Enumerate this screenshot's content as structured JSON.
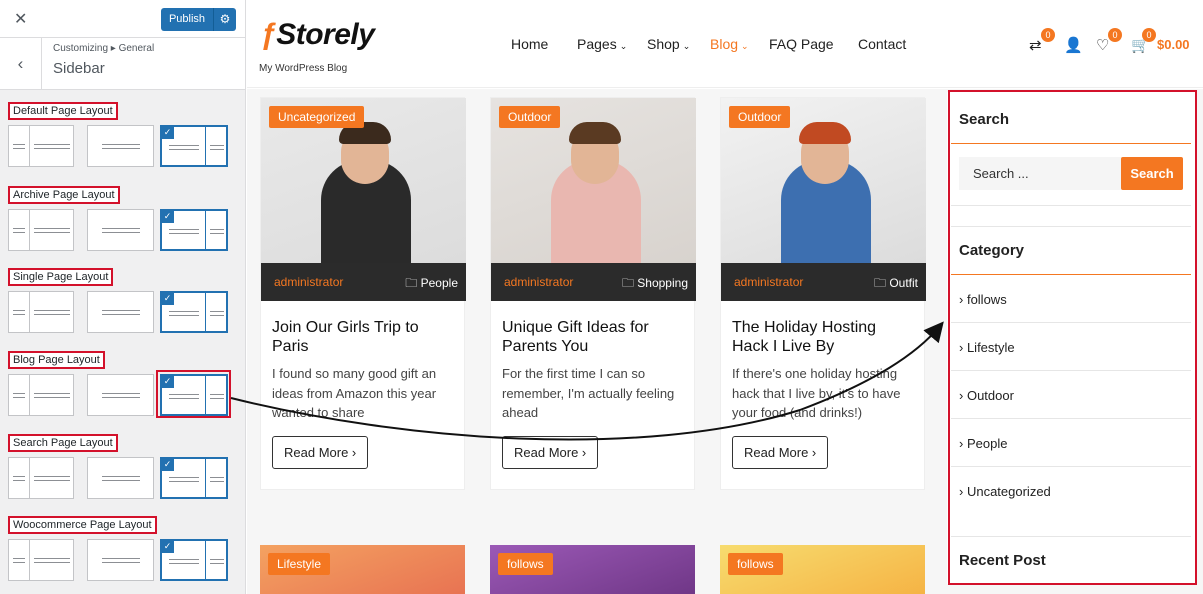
{
  "customizer": {
    "close_icon": "close-icon",
    "publish_label": "Publish",
    "settings_icon": "gear-icon",
    "back_icon": "chevron-left-icon",
    "breadcrumb": "Customizing ▸ General",
    "section_title": "Sidebar",
    "layout_groups": [
      {
        "label": "Default Page Layout",
        "selected": "right-sidebar"
      },
      {
        "label": "Archive Page Layout",
        "selected": "right-sidebar"
      },
      {
        "label": "Single Page Layout",
        "selected": "right-sidebar"
      },
      {
        "label": "Blog Page Layout",
        "selected": "right-sidebar"
      },
      {
        "label": "Search Page Layout",
        "selected": "right-sidebar"
      },
      {
        "label": "Woocommerce Page Layout",
        "selected": "right-sidebar"
      }
    ],
    "check_icon": "✓",
    "accent_color": "#2271b1",
    "highlight_color": "#d3112b"
  },
  "site": {
    "logo_text": "Storely",
    "tagline": "My WordPress Blog",
    "menu": [
      {
        "label": "Home",
        "dropdown": false,
        "active": false
      },
      {
        "label": "Pages",
        "dropdown": true,
        "active": false
      },
      {
        "label": "Shop",
        "dropdown": true,
        "active": false
      },
      {
        "label": "Blog",
        "dropdown": true,
        "active": true
      },
      {
        "label": "FAQ Page",
        "dropdown": false,
        "active": false
      },
      {
        "label": "Contact",
        "dropdown": false,
        "active": false
      }
    ],
    "header_icons": {
      "compare_count": "0",
      "wishlist_count": "0",
      "cart_count": "0",
      "cart_total": "$0.00"
    },
    "brand_color": "#f47721",
    "posts": [
      {
        "category": "Uncategorized",
        "author": "administrator",
        "tag": "People",
        "title": "Join Our Girls Trip to Paris",
        "excerpt": "I found so many good gift an ideas from Amazon this year wanted to share",
        "read_more": "Read More"
      },
      {
        "category": "Outdoor",
        "author": "administrator",
        "tag": "Shopping",
        "title": "Unique Gift Ideas for Parents You",
        "excerpt": "For the first time I can so remember, I'm actually feeling ahead",
        "read_more": "Read More"
      },
      {
        "category": "Outdoor",
        "author": "administrator",
        "tag": "Outfit",
        "title": "The Holiday Hosting Hack I Live By",
        "excerpt": "If there's one holiday hosting hack that I live by, it's to have your food (and drinks!)",
        "read_more": "Read More"
      }
    ],
    "next_posts": [
      "Lifestyle",
      "follows",
      "follows"
    ],
    "sidebar": {
      "search_title": "Search",
      "search_placeholder": "Search ...",
      "search_button": "Search",
      "category_title": "Category",
      "categories": [
        "follows",
        "Lifestyle",
        "Outdoor",
        "People",
        "Uncategorized"
      ],
      "recent_title": "Recent Post"
    }
  }
}
